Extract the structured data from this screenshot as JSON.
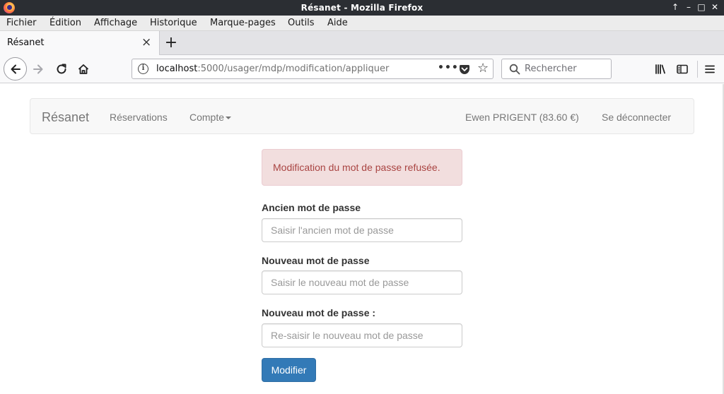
{
  "window": {
    "title": "Résanet - Mozilla Firefox",
    "controls": [
      "↑",
      "–",
      "□",
      "✕"
    ]
  },
  "menu": [
    "Fichier",
    "Édition",
    "Affichage",
    "Historique",
    "Marque-pages",
    "Outils",
    "Aide"
  ],
  "tab": {
    "label": "Résanet",
    "close": "×"
  },
  "newtab": "+",
  "urlbar": {
    "host": "localhost",
    "path": ":5000/usager/mdp/modification/appliquer",
    "dots": "•••"
  },
  "searchbar": {
    "placeholder": "Rechercher"
  },
  "site_nav": {
    "brand": "Résanet",
    "links": [
      "Réservations",
      "Compte"
    ],
    "user": "Ewen PRIGENT (83.60 €)",
    "logout": "Se déconnecter"
  },
  "alert": {
    "text": "Modification du mot de passe refusée.",
    "color": "#a94442"
  },
  "form": {
    "old_label": "Ancien mot de passe",
    "old_placeholder": "Saisir l'ancien mot de passe",
    "new_label": "Nouveau mot de passe",
    "new_placeholder": "Saisir le nouveau mot de passe",
    "confirm_label": "Nouveau mot de passe :",
    "confirm_placeholder": "Re-saisir le nouveau mot de passe",
    "submit_label": "Modifier",
    "submit_color": "#337ab7"
  }
}
